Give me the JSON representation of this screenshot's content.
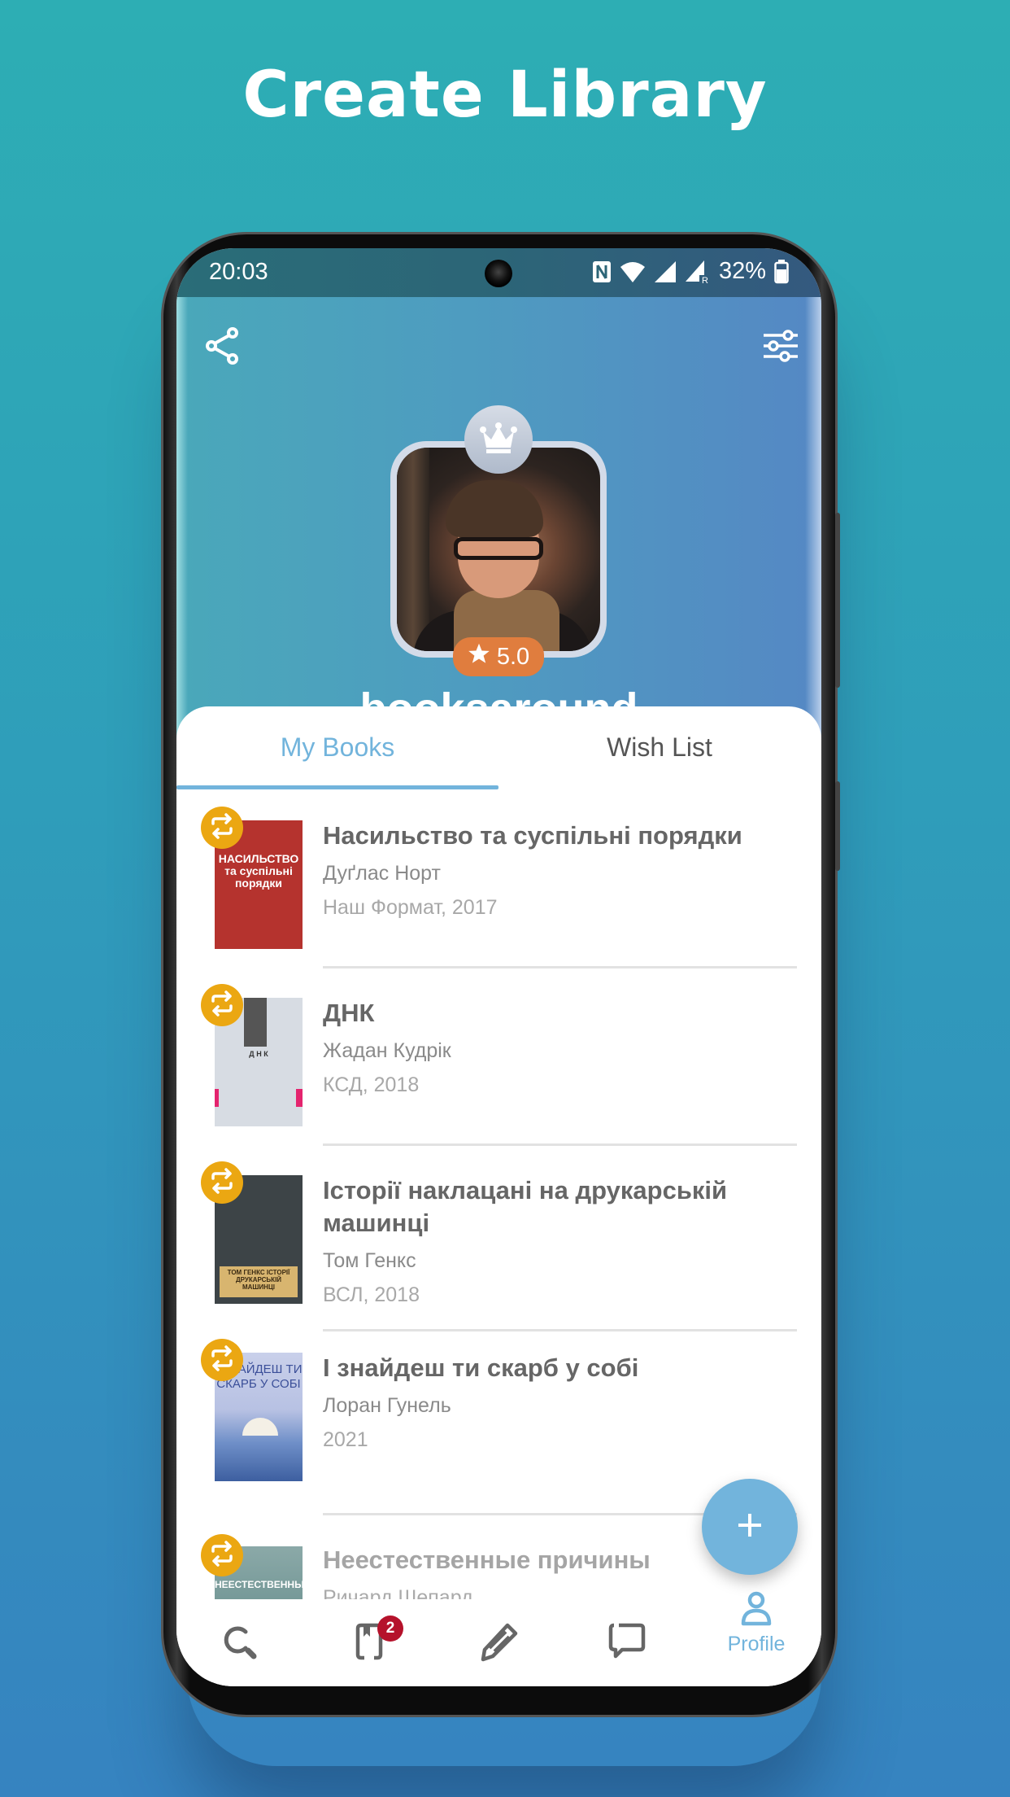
{
  "promo": {
    "title": "Create Library"
  },
  "status_bar": {
    "time": "20:03",
    "battery": "32%",
    "icons": [
      "nfc-icon",
      "wifi-icon",
      "signal-icon",
      "signal-roaming-icon",
      "battery-icon"
    ]
  },
  "header": {
    "share_icon": "share-icon",
    "filter_icon": "sliders-icon",
    "crown_icon": "crown-icon",
    "rating": "5.0",
    "username": "booksaround"
  },
  "tabs": [
    {
      "label": "My Books",
      "active": true
    },
    {
      "label": "Wish List",
      "active": false
    }
  ],
  "books": [
    {
      "title": "Насильство та суспільні порядки",
      "author": "Дуґлас Норт",
      "publisher": "Наш Формат, 2017",
      "cover_text": "НАСИЛЬСТВО та суспільні порядки"
    },
    {
      "title": "ДНК",
      "author": "Жадан Кудрік",
      "publisher": "КСД, 2018",
      "cover_text": "Д Н К"
    },
    {
      "title": "Історії наклацані на друкарській машинці",
      "author": "Том Генкс",
      "publisher": "ВСЛ, 2018",
      "cover_text": "ТОМ ГЕНКС ІСТОРІЇ ДРУКАРСЬКІЙ МАШИНЦІ"
    },
    {
      "title": "І знайдеш ти скарб у собі",
      "author": "Лоран Гунель",
      "publisher": "2021",
      "cover_text": "І ЗНАЙДЕШ ТИ СКАРБ У СОБІ"
    },
    {
      "title": "Неестественные причины",
      "author": "Ричард Шепард",
      "publisher": "",
      "cover_text": "НЕЕСТЕСТВЕННЫЕ ПРИЧИНЫ"
    }
  ],
  "fab": {
    "icon": "plus-icon"
  },
  "bottom_nav": [
    {
      "icon": "search-icon",
      "label": "",
      "badge": ""
    },
    {
      "icon": "book-icon",
      "label": "",
      "badge": "2"
    },
    {
      "icon": "pencil-icon",
      "label": "",
      "badge": ""
    },
    {
      "icon": "chat-icon",
      "label": "",
      "badge": ""
    },
    {
      "icon": "profile-icon",
      "label": "Profile",
      "badge": "",
      "active": true
    }
  ],
  "colors": {
    "accent": "#72B4DC",
    "rating": "#E07D3E",
    "swap_badge": "#EBA712",
    "notification_badge": "#B5122B",
    "text_primary": "#666666"
  }
}
